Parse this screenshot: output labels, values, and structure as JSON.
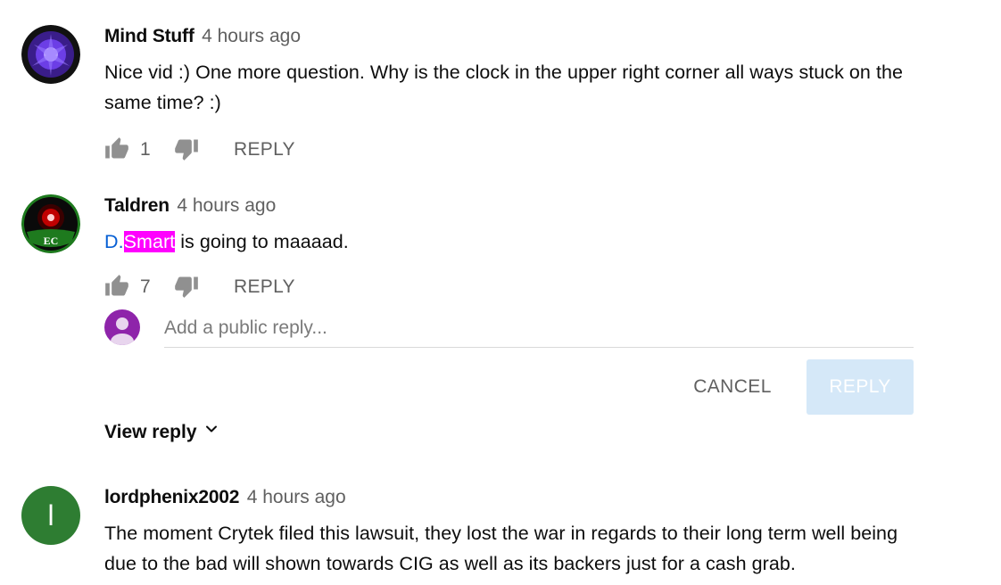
{
  "comments": [
    {
      "author": "Mind Stuff",
      "time": "4 hours ago",
      "text": "Nice vid :) One more question. Why is the clock in the upper right corner all ways stuck on the same time? :)",
      "likes": "1",
      "reply_label": "REPLY"
    },
    {
      "author": "Taldren",
      "time": "4 hours ago",
      "mention_prefix": "D.",
      "mention_highlight": "Smart",
      "text_rest": " is going to maaaad.",
      "likes": "7",
      "reply_label": "REPLY",
      "avatar_text": "EC"
    },
    {
      "author": "lordphenix2002",
      "time": "4 hours ago",
      "text": "The moment Crytek filed this lawsuit, they lost the war in regards to their long term well being due to the bad will shown towards CIG as well as its backers just for a cash grab.",
      "avatar_letter": "l"
    }
  ],
  "reply_box": {
    "placeholder": "Add a public reply...",
    "cancel_label": "CANCEL",
    "submit_label": "REPLY"
  },
  "view_reply_label": "View reply",
  "colors": {
    "mention": "#065fd4",
    "highlight": "#ff00ff",
    "submit_disabled": "#d5e8f8",
    "avatar_lordphenix": "#2e7d32",
    "avatar_me": "#8e24aa"
  }
}
